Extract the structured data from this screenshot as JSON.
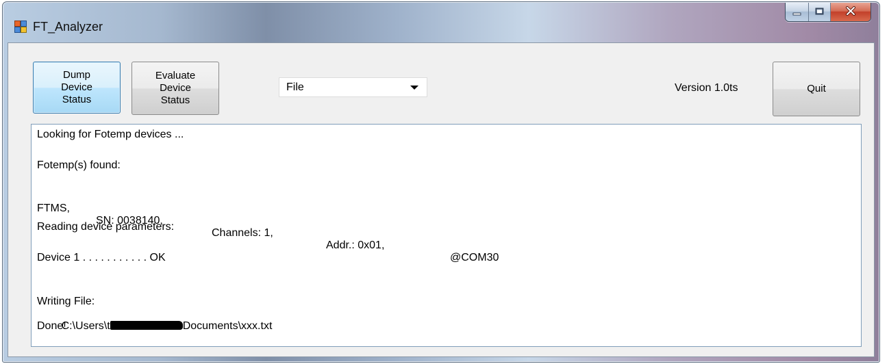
{
  "window": {
    "title": "FT_Analyzer",
    "caption_buttons": [
      "minimize-icon",
      "maximize-icon",
      "close-icon"
    ]
  },
  "toolbar": {
    "dump_button_label": "Dump\nDevice\nStatus",
    "evaluate_button_label": "Evaluate\nDevice\nStatus",
    "output_select_value": "File",
    "version_label": "Version 1.0ts",
    "quit_button_label": "Quit"
  },
  "log": {
    "looking": "Looking for Fotemp devices ...",
    "found": "Fotemp(s) found:",
    "device": {
      "type": "FTMS,",
      "sn": "SN: 0038140,",
      "channels": "Channels: 1,",
      "addr": "Addr.: 0x01,",
      "port": "@COM30"
    },
    "reading": "Reading device parameters:",
    "device_status": "Device 1 . . . . . . . . . . . OK",
    "writing": "Writing File:",
    "path_prefix": "C:\\Users\\t",
    "path_suffix": "Documents\\xxx.txt",
    "done": "Done!"
  },
  "colors": {
    "focus_border": "#3c7fb1",
    "close_red": "#c2402a"
  }
}
